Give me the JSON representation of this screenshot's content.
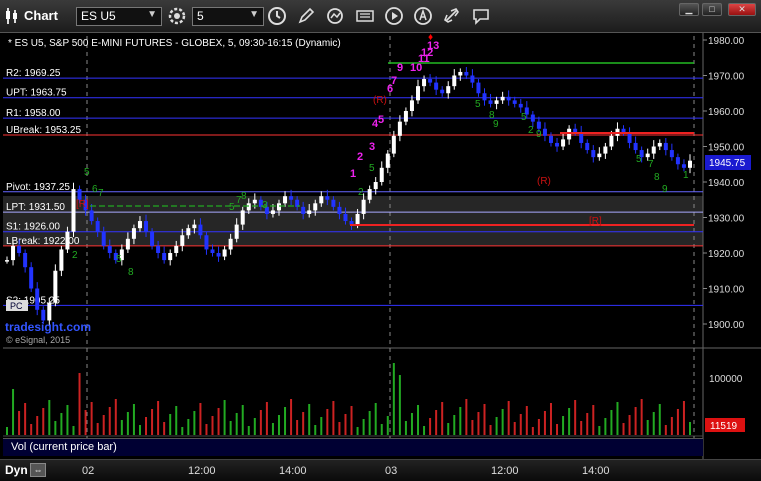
{
  "toolbar": {
    "title": "Chart",
    "symbol": "ES U5",
    "interval": "5"
  },
  "chart": {
    "header": "* ES U5, S&P 500 E-MINI FUTURES - GLOBEX, 5, 09:30-16:15 (Dynamic)",
    "price_axis_ticks": [
      "1980.00",
      "1970.00",
      "1960.00",
      "1950.00",
      "1940.00",
      "1930.00",
      "1920.00",
      "1910.00",
      "1900.00"
    ],
    "last_price": "1945.75",
    "levels": [
      {
        "label": "R2: 1969.25",
        "value": 1969.25,
        "color": "#3333ff"
      },
      {
        "label": "UPT: 1963.75",
        "value": 1963.75,
        "color": "#3333ff"
      },
      {
        "label": "R1: 1958.00",
        "value": 1958.0,
        "color": "#3333ff"
      },
      {
        "label": "UBreak: 1953.25",
        "value": 1953.25,
        "color": "#ff3333"
      },
      {
        "label": "Pivot: 1937.25",
        "value": 1937.25,
        "color": "#6666ff"
      },
      {
        "label": "LPT: 1931.50",
        "value": 1931.5,
        "color": "#aaaaff"
      },
      {
        "label": "S1: 1926.00",
        "value": 1926.0,
        "color": "#3333ff"
      },
      {
        "label": "LBreak: 1922.00",
        "value": 1922.0,
        "color": "#ff3333"
      },
      {
        "label": "S2: 1905.25",
        "value": 1905.25,
        "color": "#3333ff"
      }
    ],
    "watermark": "tradesight.com",
    "copyright": "© eSignal, 2015",
    "tags": [
      "(R)",
      "(R)",
      "[R]",
      "[R]",
      "PC"
    ]
  },
  "volume": {
    "title": "Vol (current price bar)",
    "axis_tick": "100000",
    "last_value": "11519"
  },
  "time_axis": [
    "02",
    "12:00",
    "14:00",
    "03",
    "12:00",
    "14:00"
  ],
  "bottom": {
    "mode": "Dyn"
  }
}
